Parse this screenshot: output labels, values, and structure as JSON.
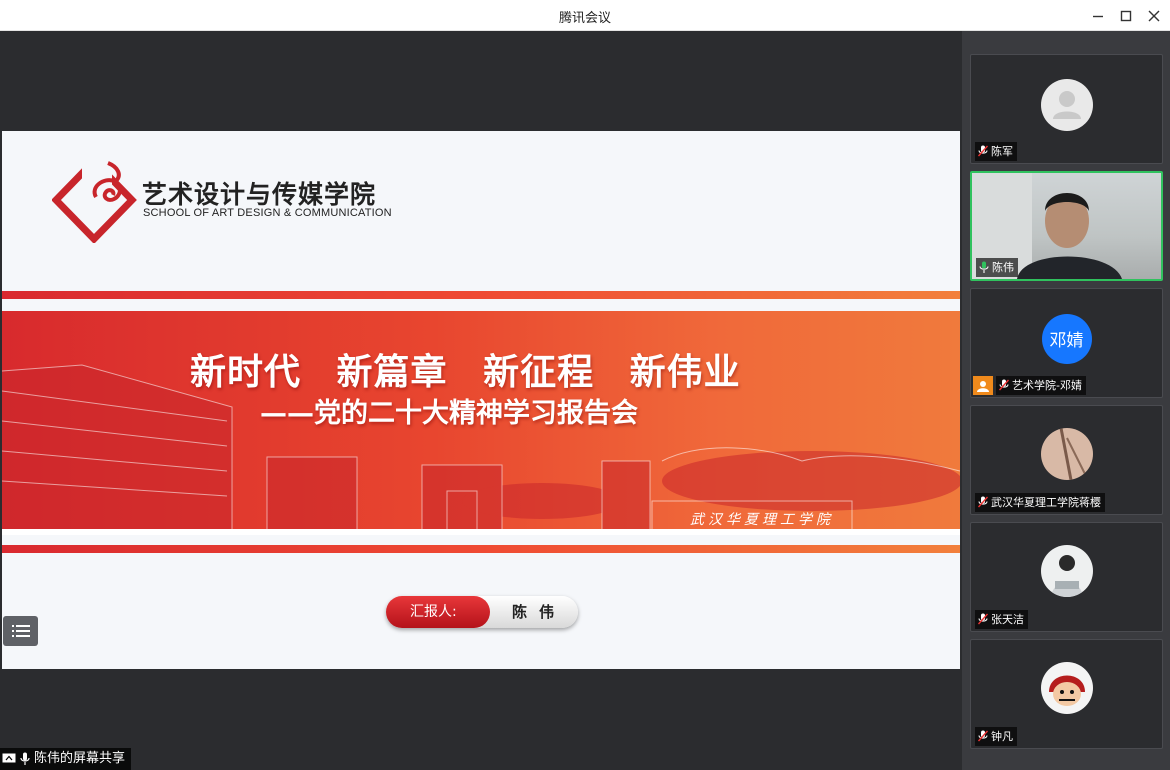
{
  "window": {
    "title": "腾讯会议"
  },
  "slide": {
    "logo_cn": "艺术设计与传媒学院",
    "logo_en": "SCHOOL OF ART DESIGN & COMMUNICATION",
    "headline": "新时代 新篇章 新征程 新伟业",
    "subline": "——党的二十大精神学习报告会",
    "calligraphy": "武汉华夏理工学院",
    "reporter_label": "汇报人:",
    "reporter_name": "陈伟"
  },
  "share_status": "陈伟的屏幕共享",
  "participants": [
    {
      "name": "陈军",
      "avatar": "default-avatar",
      "mic": "muted"
    },
    {
      "name": "陈伟",
      "avatar": "video",
      "mic": "active",
      "speaking": true
    },
    {
      "name": "艺术学院-邓婧",
      "avatar_text": "邓婧",
      "mic": "muted",
      "host_badge": true
    },
    {
      "name": "武汉华夏理工学院蒋樱",
      "avatar": "photo",
      "mic": "muted"
    },
    {
      "name": "张天洁",
      "avatar": "photo",
      "mic": "muted"
    },
    {
      "name": "钟凡",
      "avatar": "photo",
      "mic": "muted"
    }
  ],
  "colors": {
    "accent_red": "#d82a2d",
    "speaking_green": "#30c25e",
    "avatar_blue": "#1677ff"
  }
}
